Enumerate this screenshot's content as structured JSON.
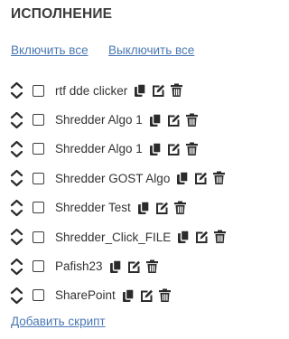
{
  "section": {
    "title": "ИСПОЛНЕНИЕ"
  },
  "controls": {
    "enable_all": "Включить все",
    "disable_all": "Выключить все"
  },
  "scripts": [
    {
      "name": "rtf dde clicker",
      "enabled": false
    },
    {
      "name": "Shredder Algo 1",
      "enabled": false
    },
    {
      "name": "Shredder Algo 1",
      "enabled": false
    },
    {
      "name": "Shredder GOST Algo",
      "enabled": false
    },
    {
      "name": "Shredder Test",
      "enabled": false
    },
    {
      "name": "Shredder_Click_FILE",
      "enabled": false
    },
    {
      "name": "Pafish23",
      "enabled": false
    },
    {
      "name": "SharePoint",
      "enabled": false
    }
  ],
  "row_icons": [
    "sort-icon",
    "copy-icon",
    "edit-icon",
    "trash-icon"
  ],
  "footer": {
    "add_script": "Добавить скрипт"
  },
  "colors": {
    "link": "#4a78b5",
    "text": "#333333",
    "icon": "#2b2b2b"
  }
}
